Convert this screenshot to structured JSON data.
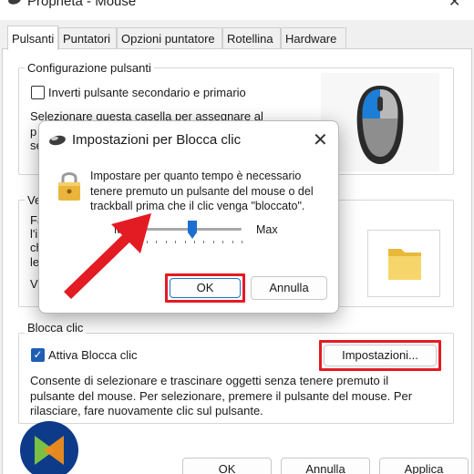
{
  "window": {
    "title": "Proprietà - Mouse",
    "close_glyph": "✕"
  },
  "tabs": [
    {
      "label": "Pulsanti",
      "active": true
    },
    {
      "label": "Puntatori"
    },
    {
      "label": "Opzioni puntatore"
    },
    {
      "label": "Rotellina"
    },
    {
      "label": "Hardware"
    }
  ],
  "button_config": {
    "title": "Configurazione pulsanti",
    "checkbox_label": "Inverti pulsante secondario e primario",
    "checked": false,
    "description_line1": "Selezionare questa casella per assegnare al",
    "description_line2": "p",
    "description_line3": "se"
  },
  "double_click": {
    "title": "Ve",
    "lines": [
      "Fa",
      "l'i",
      "ch",
      "le",
      "V"
    ]
  },
  "click_lock": {
    "title": "Blocca clic",
    "checkbox_label": "Attiva Blocca clic",
    "checked": true,
    "settings_button": "Impostazioni...",
    "description": [
      "Consente di selezionare e trascinare oggetti senza tenere premuto il",
      "pulsante del mouse. Per selezionare, premere il pulsante del mouse. Per",
      "rilasciare, fare nuovamente clic sul pulsante."
    ]
  },
  "footer": {
    "ok": "OK",
    "cancel": "Annulla",
    "apply": "Applica"
  },
  "dialog": {
    "title": "Impostazioni per Blocca clic",
    "close_glyph": "✕",
    "text_lines": [
      "Impostare per quanto tempo è necessario",
      "tenere premuto un pulsante del mouse o del",
      "trackball prima che il clic venga \"bloccato\"."
    ],
    "slider_min": "Min",
    "slider_max": "Max",
    "slider_value": 0.5,
    "ok": "OK",
    "cancel": "Annulla"
  },
  "colors": {
    "highlight": "#e31b23",
    "arrow": "#e31b23",
    "accent": "#1e5fb4"
  },
  "icons": [
    "mouse-icon",
    "lock-icon",
    "folder-icon",
    "checkmark-icon",
    "close-icon",
    "arrow-annotation",
    "logo"
  ]
}
